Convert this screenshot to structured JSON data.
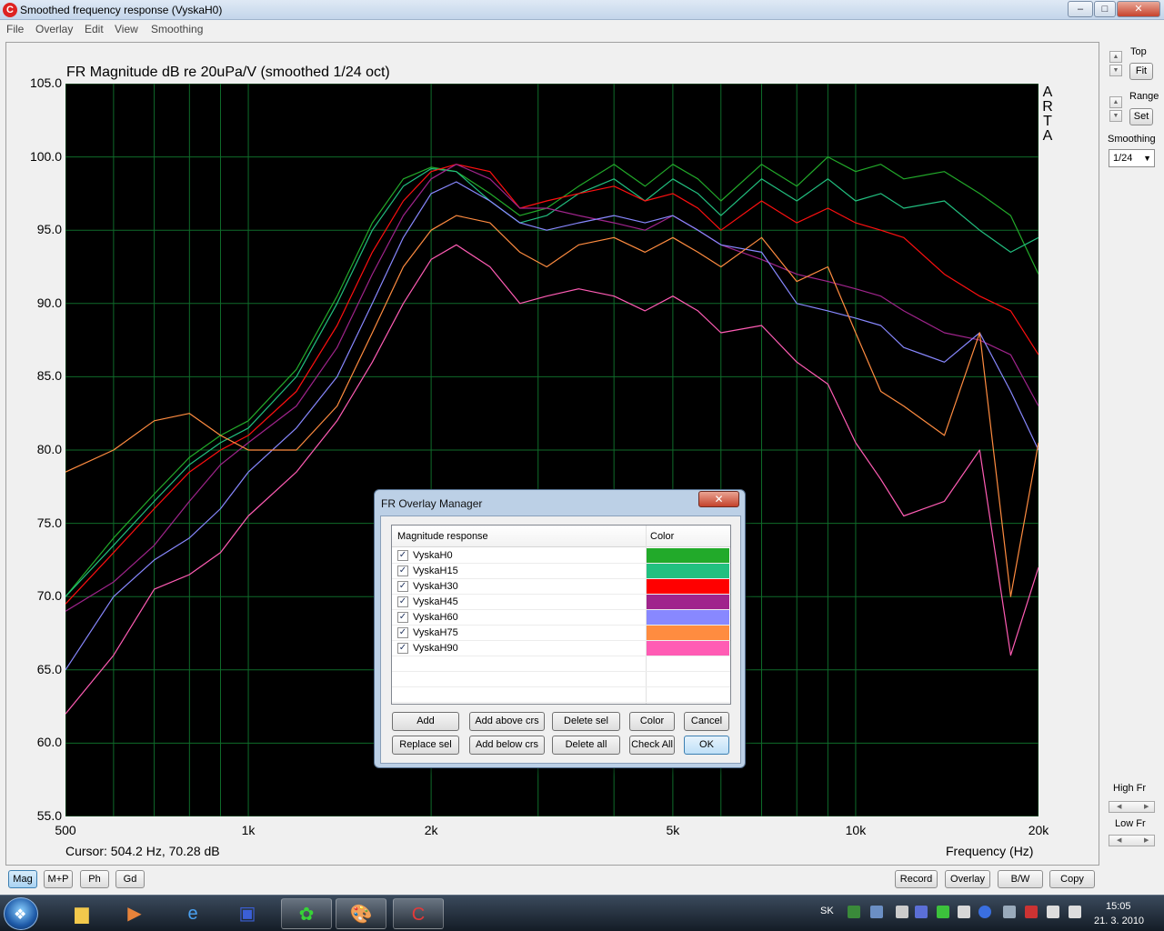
{
  "window": {
    "title": "Smoothed frequency response (VyskaH0)",
    "app_icon_glyph": "C",
    "minimize": "–",
    "maximize": "□",
    "close": "✕"
  },
  "menu": [
    "File",
    "Overlay",
    "Edit",
    "View",
    "Smoothing"
  ],
  "chart_data": {
    "type": "line",
    "title": "FR Magnitude dB re 20uPa/V (smoothed 1/24 oct)",
    "xlabel": "Frequency (Hz)",
    "ylabel": "",
    "x_scale": "log",
    "xlim": [
      500,
      20000
    ],
    "ylim": [
      55,
      105
    ],
    "y_ticks": [
      "105.0",
      "100.0",
      "95.0",
      "90.0",
      "85.0",
      "80.0",
      "75.0",
      "70.0",
      "65.0",
      "60.0",
      "55.0"
    ],
    "x_ticks": [
      {
        "value": 500,
        "label": "500"
      },
      {
        "value": 1000,
        "label": "1k"
      },
      {
        "value": 2000,
        "label": "2k"
      },
      {
        "value": 5000,
        "label": "5k"
      },
      {
        "value": 10000,
        "label": "10k"
      },
      {
        "value": 20000,
        "label": "20k"
      }
    ],
    "grid": true,
    "background": "#000000",
    "grid_color": "#0f6b2a",
    "series": [
      {
        "name": "VyskaH0",
        "color": "#22aa2a",
        "x": [
          500,
          600,
          700,
          800,
          900,
          1000,
          1200,
          1400,
          1600,
          1800,
          2000,
          2200,
          2500,
          2800,
          3100,
          3500,
          4000,
          4500,
          5000,
          5500,
          6000,
          7000,
          8000,
          9000,
          10000,
          11000,
          12000,
          14000,
          16000,
          18000,
          20000
        ],
        "y": [
          70.0,
          74.0,
          77.0,
          79.5,
          81.0,
          82.0,
          85.5,
          90.5,
          95.5,
          98.5,
          99.3,
          99.0,
          97.5,
          96.0,
          96.5,
          98.0,
          99.5,
          98.0,
          99.5,
          98.5,
          97.0,
          99.5,
          98.0,
          100.0,
          99.0,
          99.5,
          98.5,
          99.0,
          97.5,
          96.0,
          92.0
        ]
      },
      {
        "name": "VyskaH15",
        "color": "#22c080",
        "x": [
          500,
          600,
          700,
          800,
          900,
          1000,
          1200,
          1400,
          1600,
          1800,
          2000,
          2200,
          2500,
          2800,
          3100,
          3500,
          4000,
          4500,
          5000,
          5500,
          6000,
          7000,
          8000,
          9000,
          10000,
          11000,
          12000,
          14000,
          16000,
          18000,
          20000
        ],
        "y": [
          70.0,
          73.5,
          76.5,
          79.0,
          80.5,
          81.5,
          85.0,
          90.0,
          95.0,
          98.0,
          99.2,
          99.0,
          97.0,
          95.5,
          96.0,
          97.5,
          98.5,
          97.0,
          98.5,
          97.5,
          96.0,
          98.5,
          97.0,
          98.5,
          97.0,
          97.5,
          96.5,
          97.0,
          95.0,
          93.5,
          94.5
        ]
      },
      {
        "name": "VyskaH30",
        "color": "#ff1010",
        "x": [
          500,
          600,
          700,
          800,
          900,
          1000,
          1200,
          1400,
          1600,
          1800,
          2000,
          2200,
          2500,
          2800,
          3100,
          3500,
          4000,
          4500,
          5000,
          5500,
          6000,
          7000,
          8000,
          9000,
          10000,
          11000,
          12000,
          14000,
          16000,
          18000,
          20000
        ],
        "y": [
          69.5,
          73.0,
          76.0,
          78.5,
          80.0,
          81.0,
          84.0,
          88.5,
          93.5,
          97.0,
          99.0,
          99.5,
          99.0,
          96.5,
          97.0,
          97.5,
          98.0,
          97.0,
          97.5,
          96.5,
          95.0,
          97.0,
          95.5,
          96.5,
          95.5,
          95.0,
          94.5,
          92.0,
          90.5,
          89.5,
          86.5
        ]
      },
      {
        "name": "VyskaH45",
        "color": "#a0248c",
        "x": [
          500,
          600,
          700,
          800,
          900,
          1000,
          1200,
          1400,
          1600,
          1800,
          2000,
          2200,
          2500,
          2800,
          3100,
          3500,
          4000,
          4500,
          5000,
          5500,
          6000,
          7000,
          8000,
          9000,
          10000,
          11000,
          12000,
          14000,
          16000,
          18000,
          20000
        ],
        "y": [
          69.0,
          71.0,
          73.5,
          76.5,
          79.0,
          80.5,
          83.0,
          87.0,
          92.0,
          96.0,
          98.5,
          99.5,
          98.5,
          96.5,
          96.5,
          96.0,
          95.5,
          95.0,
          96.0,
          95.0,
          94.0,
          93.0,
          92.0,
          91.5,
          91.0,
          90.5,
          89.5,
          88.0,
          87.5,
          86.5,
          83.0
        ]
      },
      {
        "name": "VyskaH60",
        "color": "#8888ff",
        "x": [
          500,
          600,
          700,
          800,
          900,
          1000,
          1200,
          1400,
          1600,
          1800,
          2000,
          2200,
          2500,
          2800,
          3100,
          3500,
          4000,
          4500,
          5000,
          5500,
          6000,
          7000,
          8000,
          9000,
          10000,
          11000,
          12000,
          14000,
          16000,
          18000,
          20000
        ],
        "y": [
          65.0,
          70.0,
          72.5,
          74.0,
          76.0,
          78.5,
          81.5,
          85.0,
          90.0,
          94.5,
          97.5,
          98.3,
          97.0,
          95.5,
          95.0,
          95.5,
          96.0,
          95.5,
          96.0,
          95.0,
          94.0,
          93.5,
          90.0,
          89.5,
          89.0,
          88.5,
          87.0,
          86.0,
          88.0,
          84.0,
          80.0
        ]
      },
      {
        "name": "VyskaH75",
        "color": "#ff8c40",
        "x": [
          500,
          600,
          700,
          800,
          900,
          1000,
          1200,
          1400,
          1600,
          1800,
          2000,
          2200,
          2500,
          2800,
          3100,
          3500,
          4000,
          4500,
          5000,
          5500,
          6000,
          7000,
          8000,
          9000,
          10000,
          11000,
          12000,
          14000,
          16000,
          18000,
          20000
        ],
        "y": [
          78.5,
          80.0,
          82.0,
          82.5,
          81.0,
          80.0,
          80.0,
          83.0,
          88.0,
          92.5,
          95.0,
          96.0,
          95.5,
          93.5,
          92.5,
          94.0,
          94.5,
          93.5,
          94.5,
          93.5,
          92.5,
          94.5,
          91.5,
          92.5,
          88.0,
          84.0,
          83.0,
          81.0,
          88.0,
          70.0,
          80.5
        ]
      },
      {
        "name": "VyskaH90",
        "color": "#ff5cb4",
        "x": [
          500,
          600,
          700,
          800,
          900,
          1000,
          1200,
          1400,
          1600,
          1800,
          2000,
          2200,
          2500,
          2800,
          3100,
          3500,
          4000,
          4500,
          5000,
          5500,
          6000,
          7000,
          8000,
          9000,
          10000,
          11000,
          12000,
          14000,
          16000,
          18000,
          20000
        ],
        "y": [
          62.0,
          66.0,
          70.5,
          71.5,
          73.0,
          75.5,
          78.5,
          82.0,
          86.0,
          90.0,
          93.0,
          94.0,
          92.5,
          90.0,
          90.5,
          91.0,
          90.5,
          89.5,
          90.5,
          89.5,
          88.0,
          88.5,
          86.0,
          84.5,
          80.5,
          78.0,
          75.5,
          76.5,
          80.0,
          66.0,
          72.0
        ]
      }
    ]
  },
  "arta_letters": [
    "A",
    "R",
    "T",
    "A"
  ],
  "status": {
    "cursor": "Cursor: 504.2 Hz, 70.28 dB"
  },
  "side_panel": {
    "top_label": "Top",
    "fit_button": "Fit",
    "range_label": "Range",
    "set_button": "Set",
    "smoothing_label": "Smoothing",
    "smoothing_value": "1/24",
    "high_fr_label": "High Fr",
    "low_fr_label": "Low Fr"
  },
  "bottom_left_buttons": [
    "Mag",
    "M+P",
    "Ph",
    "Gd"
  ],
  "bottom_right_buttons": [
    "Record",
    "Overlay",
    "B/W",
    "Copy"
  ],
  "dialog": {
    "title": "FR Overlay Manager",
    "close": "✕",
    "col_response": "Magnitude response",
    "col_color": "Color",
    "check_glyph": "✓",
    "rows": [
      {
        "name": "VyskaH0",
        "color": "#22aa2a"
      },
      {
        "name": "VyskaH15",
        "color": "#22c080"
      },
      {
        "name": "VyskaH30",
        "color": "#ff0000"
      },
      {
        "name": "VyskaH45",
        "color": "#a0248c"
      },
      {
        "name": "VyskaH60",
        "color": "#8888ff"
      },
      {
        "name": "VyskaH75",
        "color": "#ff8c40"
      },
      {
        "name": "VyskaH90",
        "color": "#ff5cb4"
      }
    ],
    "buttons_row1": [
      "Add",
      "Add above crs",
      "Delete sel",
      "Color",
      "Cancel"
    ],
    "buttons_row2": [
      "Replace sel",
      "Add below crs",
      "Delete all",
      "Check All",
      "OK"
    ]
  },
  "taskbar": {
    "start_glyph": "❖",
    "apps": [
      {
        "icon": "folder-icon",
        "glyph": "▆"
      },
      {
        "icon": "media-player-icon",
        "glyph": "▶"
      },
      {
        "icon": "internet-explorer-icon",
        "glyph": "e"
      },
      {
        "icon": "floppy-disk-icon",
        "glyph": "▣"
      },
      {
        "icon": "icq-flower-icon",
        "glyph": "✿"
      },
      {
        "icon": "paint-palette-icon",
        "glyph": "🎨"
      },
      {
        "icon": "arta-app-icon",
        "glyph": "C"
      }
    ],
    "language": "SK",
    "time": "15:05",
    "date": "21. 3. 2010"
  }
}
